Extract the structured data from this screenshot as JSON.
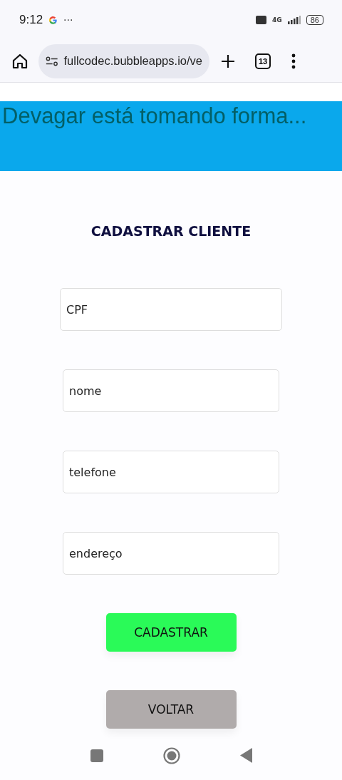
{
  "status_bar": {
    "time": "9:12",
    "more": "···",
    "network": "4G",
    "battery": "86"
  },
  "browser": {
    "url": "fullcodec.bubbleapps.io/ve",
    "tab_count": "13"
  },
  "banner": {
    "text": "Devagar está tomando forma..."
  },
  "form": {
    "title": "CADASTRAR CLIENTE",
    "fields": [
      {
        "placeholder": "CPF"
      },
      {
        "placeholder": "nome"
      },
      {
        "placeholder": "telefone"
      },
      {
        "placeholder": "endereço"
      }
    ],
    "buttons": [
      {
        "label": "CADASTRAR",
        "kind": "primary"
      },
      {
        "label": "VOLTAR",
        "kind": "secondary"
      }
    ]
  }
}
